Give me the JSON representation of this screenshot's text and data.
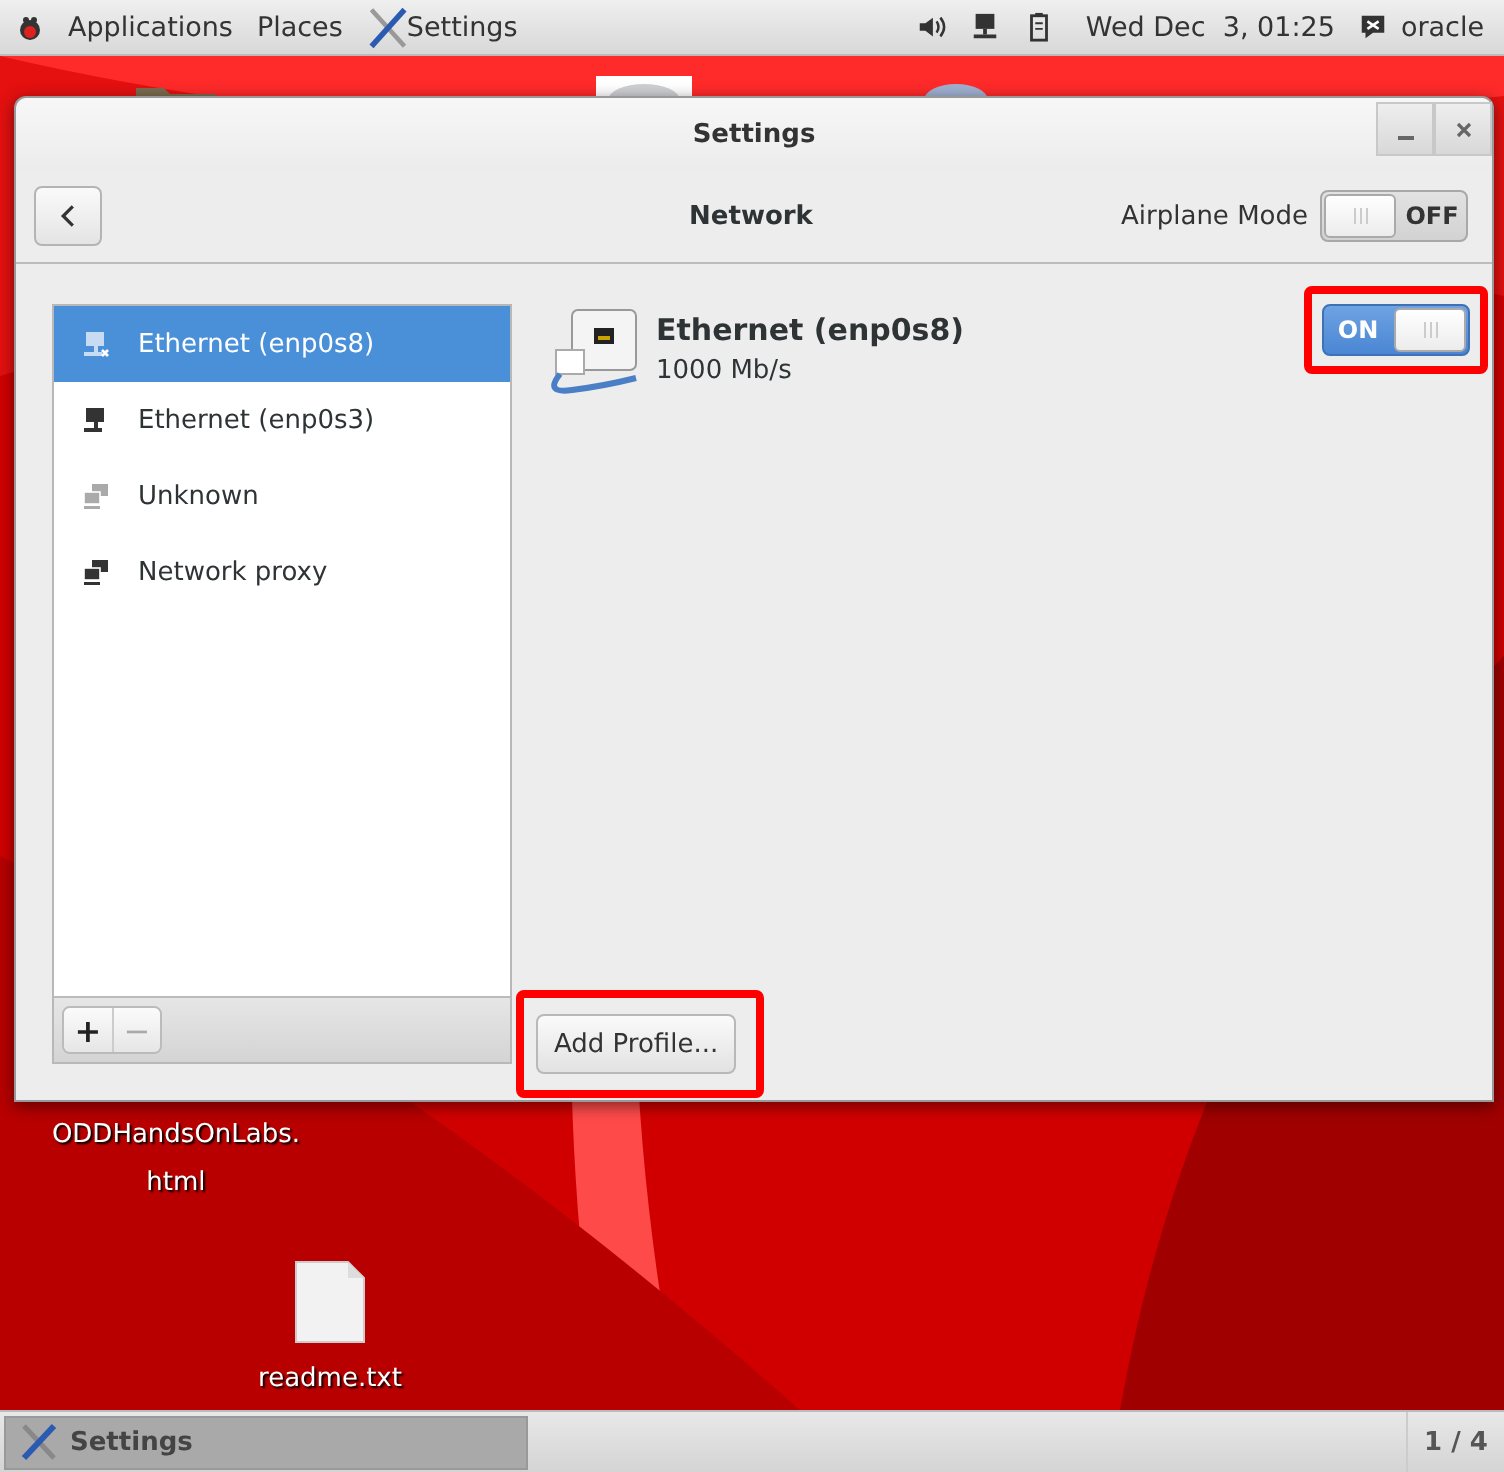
{
  "top_bar": {
    "menus": [
      "Applications",
      "Places"
    ],
    "app": "Settings",
    "clock": "Wed Dec  3, 01:25",
    "user": "oracle"
  },
  "desktop_icons": [
    {
      "kind": "html",
      "lines": [
        "ODDHandsOnLabs.",
        "html"
      ]
    },
    {
      "kind": "text",
      "lines": [
        "readme.txt"
      ]
    }
  ],
  "window": {
    "title": "Settings",
    "page_title": "Network",
    "airplane_mode": {
      "label": "Airplane Mode",
      "on": false,
      "state_text": "OFF"
    }
  },
  "devices": [
    {
      "name": "Ethernet (enp0s8)",
      "kind": "wired-off",
      "selected": true
    },
    {
      "name": "Ethernet (enp0s3)",
      "kind": "wired",
      "selected": false
    },
    {
      "name": "Unknown",
      "kind": "unknown",
      "selected": false
    },
    {
      "name": "Network proxy",
      "kind": "proxy",
      "selected": false
    }
  ],
  "list_buttons": [
    {
      "label": "+",
      "disabled": false
    },
    {
      "label": "−",
      "disabled": true
    }
  ],
  "detail": {
    "name": "Ethernet (enp0s8)",
    "speed": "1000 Mb/s",
    "switch": {
      "on": true,
      "state_text": "ON",
      "highlighted": true
    }
  },
  "add_profile": {
    "label": "Add Profile...",
    "highlighted": true
  },
  "taskbar": {
    "task": "Settings",
    "workspace": "1 / 4"
  }
}
